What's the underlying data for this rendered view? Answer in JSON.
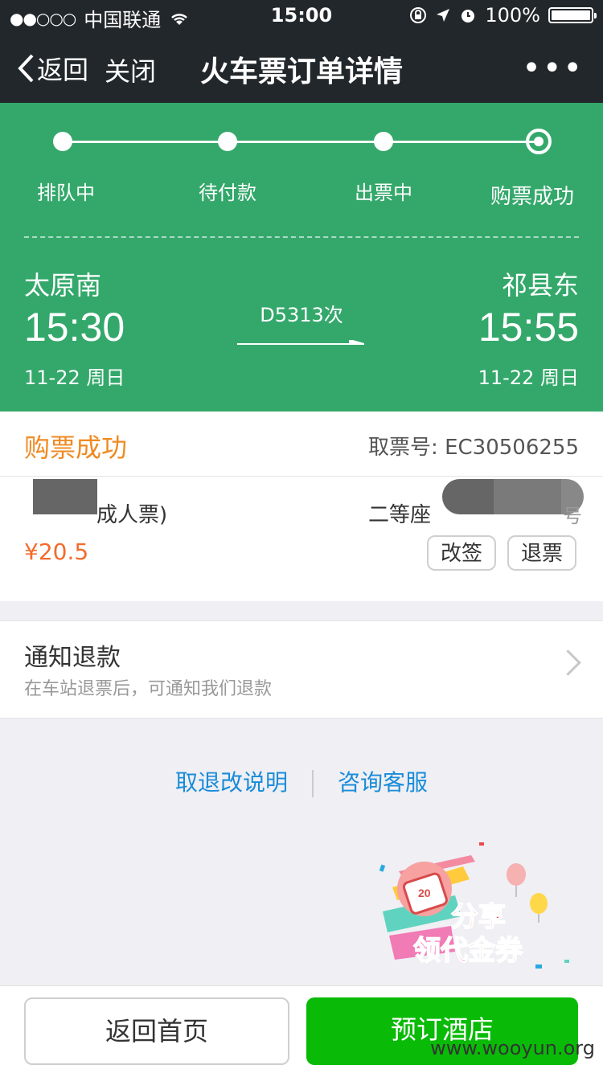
{
  "status_bar": {
    "carrier": "中国联通",
    "time": "15:00",
    "battery": "100%",
    "battery_level": 1.0
  },
  "nav": {
    "back_label": "返回",
    "close_label": "关闭",
    "title": "火车票订单详情",
    "more_label": "•••"
  },
  "progress": {
    "steps": [
      "排队中",
      "待付款",
      "出票中",
      "购票成功"
    ],
    "current_step": 4
  },
  "trip": {
    "from": {
      "station": "太原南",
      "time": "15:30",
      "date": "11-22 周日"
    },
    "to": {
      "station": "祁县东",
      "time": "15:55",
      "date": "11-22 周日"
    },
    "train_no": "D5313次"
  },
  "order": {
    "status": "购票成功",
    "pickup_label": "取票号:",
    "pickup_no": "EC30506255",
    "passenger_type": "成人票)",
    "seat_class": "二等座",
    "seat_suffix": "号",
    "price": "¥20.5",
    "change_button": "改签",
    "refund_button": "退票"
  },
  "refund_notice": {
    "title": "通知退款",
    "subtitle": "在车站退票后，可通知我们退款"
  },
  "links": {
    "rules": "取退改说明",
    "service": "咨询客服"
  },
  "promo": {
    "line1": "分享",
    "line2": "领代金券",
    "badge": "20"
  },
  "bottom": {
    "home_button": "返回首页",
    "hotel_button": "预订酒店"
  },
  "watermark": "www.wooyun.org",
  "colors": {
    "header_bg": "#22272b",
    "accent_green": "#34a86b",
    "success_orange": "#f08a24",
    "price_red": "#f36b2b",
    "link_blue": "#1a8cd8",
    "primary_button": "#09bb07"
  }
}
